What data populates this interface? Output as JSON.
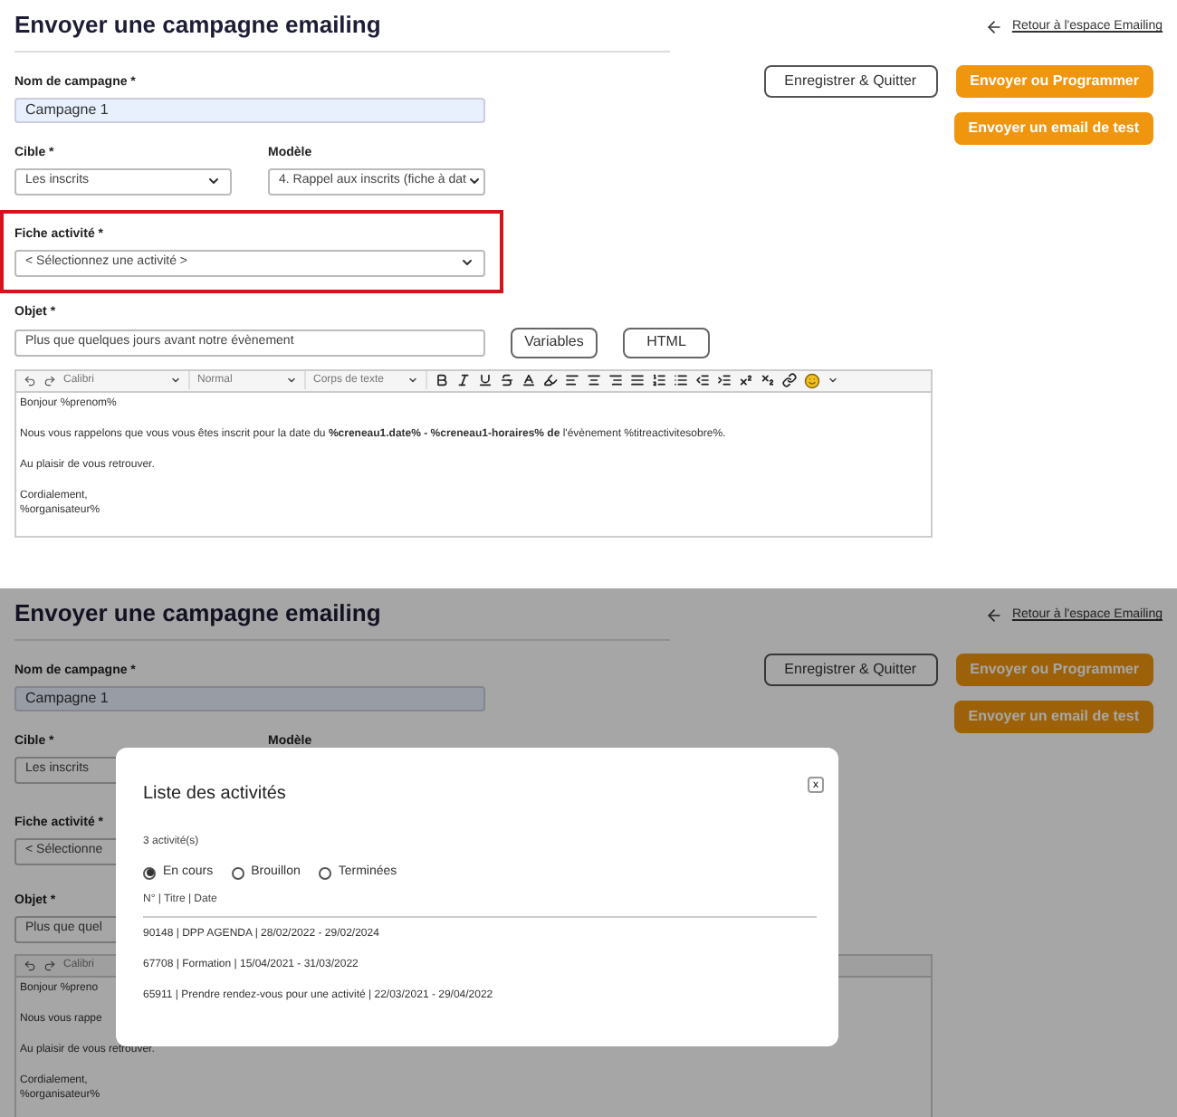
{
  "form_view": {
    "title": "Envoyer une campagne emailing",
    "back_link": "Retour à l'espace Emailing",
    "buttons": [
      {
        "label": "Enregistrer & Quitter",
        "kind": "outline"
      },
      {
        "label": "Envoyer ou Programmer",
        "kind": "primary"
      },
      {
        "label": "Envoyer un email de test",
        "kind": "primary"
      }
    ],
    "campaign_name": {
      "label": "Nom de campagne *",
      "value": "Campagne 1"
    },
    "target": {
      "label": "Cible *",
      "value": "Les inscrits"
    },
    "template": {
      "label": "Modèle",
      "value": "4. Rappel aux inscrits (fiche à dat"
    },
    "activity": {
      "label": "Fiche activité *",
      "value": "< Sélectionnez une activité >",
      "highlighted": true
    },
    "subject": {
      "label": "Objet *",
      "value": "Plus que quelques jours avant notre évènement"
    },
    "subject_buttons": [
      "Variables",
      "HTML"
    ],
    "toolbar": {
      "font": "Calibri",
      "style": "Normal",
      "block": "Corps de texte"
    },
    "body": [
      [
        "Bonjour %prenom%"
      ],
      [
        "Nous vous rappelons que vous vous êtes inscrit pour la date du **%creneau1.date% - %creneau1-horaires% de** l'évènement %titreactivitesobre%."
      ],
      [
        "Au plaisir de vous retrouver."
      ],
      [
        "Cordialement,",
        "%organisateur%"
      ]
    ]
  },
  "modal_view": {
    "form": {
      "title": "Envoyer une campagne emailing",
      "back_link": "Retour à l'espace Emailing",
      "buttons": [
        {
          "label": "Enregistrer & Quitter",
          "kind": "outline"
        },
        {
          "label": "Envoyer ou Programmer",
          "kind": "primary"
        },
        {
          "label": "Envoyer un email de test",
          "kind": "primary"
        }
      ],
      "campaign_name": {
        "label": "Nom de campagne *",
        "value": "Campagne 1"
      },
      "target": {
        "label": "Cible *",
        "value": "Les inscrits"
      },
      "template": {
        "label": "Modèle"
      },
      "activity": {
        "label": "Fiche activité *",
        "value": "< Sélectionne",
        "highlighted": false
      },
      "subject": {
        "label": "Objet *",
        "value": "Plus que quel"
      },
      "toolbar": {
        "font": "Calibri"
      },
      "body": [
        [
          "Bonjour %preno"
        ],
        [
          "Nous vous rappe"
        ],
        [
          "Au plaisir de vous retrouver."
        ],
        [
          "Cordialement,",
          "%organisateur%"
        ]
      ]
    },
    "modal": {
      "title": "Liste des activités",
      "close": "x",
      "count": "3 activité(s)",
      "filters": [
        {
          "label": "En cours",
          "selected": true
        },
        {
          "label": "Brouillon",
          "selected": false
        },
        {
          "label": "Terminées",
          "selected": false
        }
      ],
      "header": "N° | Titre | Date",
      "rows": [
        "90148 | DPP AGENDA | 28/02/2022 - 29/02/2024",
        "67708 | Formation | 15/04/2021 - 31/03/2022",
        "65911 | Prendre rendez-vous pour une activité | 22/03/2021 - 29/04/2022"
      ]
    }
  }
}
